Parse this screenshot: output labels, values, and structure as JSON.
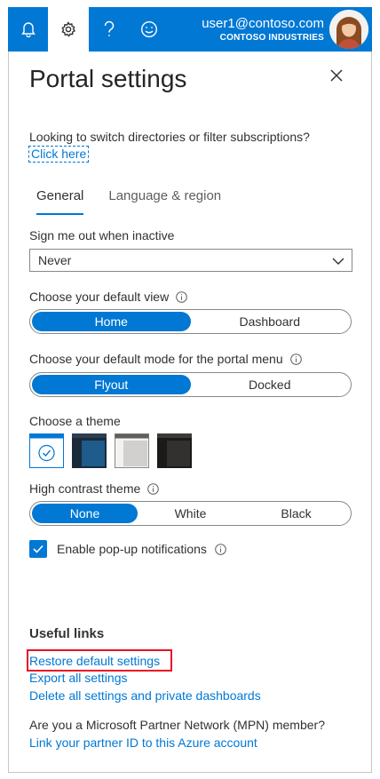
{
  "header": {
    "email": "user1@contoso.com",
    "organization": "CONTOSO INDUSTRIES",
    "buttons": [
      {
        "icon": "bell-icon"
      },
      {
        "icon": "gear-icon",
        "active": true
      },
      {
        "icon": "help-icon"
      },
      {
        "icon": "smiley-icon"
      }
    ],
    "accent_color": "#0078d4"
  },
  "panel": {
    "title": "Portal settings",
    "switch_text": "Looking to switch directories or filter subscriptions?",
    "switch_link": "Click here",
    "tabs": [
      {
        "label": "General",
        "active": true
      },
      {
        "label": "Language & region",
        "active": false
      }
    ],
    "signout": {
      "label": "Sign me out when inactive",
      "value": "Never"
    },
    "default_view": {
      "label": "Choose your default view",
      "options": [
        "Home",
        "Dashboard"
      ],
      "selected": "Home"
    },
    "menu_mode": {
      "label": "Choose your default mode for the portal menu",
      "options": [
        "Flyout",
        "Docked"
      ],
      "selected": "Flyout"
    },
    "theme": {
      "label": "Choose a theme",
      "options": [
        "light",
        "dark-blue",
        "light-gray",
        "dark"
      ],
      "selected": "light"
    },
    "high_contrast": {
      "label": "High contrast theme",
      "options": [
        "None",
        "White",
        "Black"
      ],
      "selected": "None"
    },
    "popup": {
      "label": "Enable pop-up notifications",
      "checked": true
    },
    "useful_links": {
      "heading": "Useful links",
      "links": [
        "Restore default settings",
        "Export all settings",
        "Delete all settings and private dashboards"
      ]
    },
    "partner": {
      "text": "Are you a Microsoft Partner Network (MPN) member?",
      "link": "Link your partner ID to this Azure account"
    }
  }
}
